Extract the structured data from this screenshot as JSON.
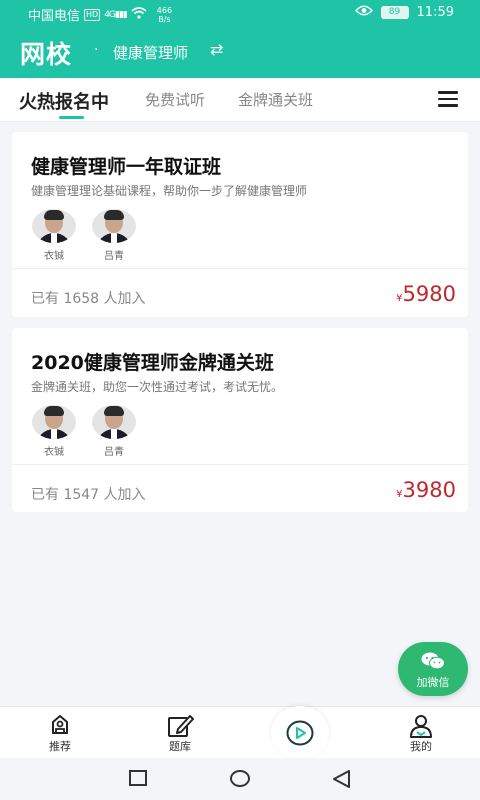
{
  "status_bar": {
    "carrier": "中国电信",
    "hd": "HD",
    "signal": "4G",
    "speed_value": "466",
    "speed_unit": "B/s",
    "battery": "89",
    "time": "11:59"
  },
  "header": {
    "brand": "网校",
    "separator": "·",
    "course": "健康管理师",
    "switch_icon": "⇄"
  },
  "tabs": [
    {
      "label": "火热报名中",
      "active": true
    },
    {
      "label": "免费试听",
      "active": false
    },
    {
      "label": "金牌通关班",
      "active": false
    }
  ],
  "courses": [
    {
      "title": "健康管理师一年取证班",
      "description": "健康管理理论基础课程，帮助你一步了解健康管理师",
      "teachers": [
        {
          "name": "衣铖"
        },
        {
          "name": "吕青"
        }
      ],
      "enrolled_prefix": "已有 ",
      "enrolled_count": "1658",
      "enrolled_suffix": " 人加入",
      "currency": "¥",
      "price": "5980"
    },
    {
      "title": "2020健康管理师金牌通关班",
      "description": "金牌通关班，助您一次性通过考试，考试无忧。",
      "teachers": [
        {
          "name": "衣铖"
        },
        {
          "name": "吕青"
        }
      ],
      "enrolled_prefix": "已有 ",
      "enrolled_count": "1547",
      "enrolled_suffix": " 人加入",
      "currency": "¥",
      "price": "3980"
    }
  ],
  "wechat_button": {
    "label": "加微信",
    "icon": "wechat-icon"
  },
  "bottom_nav": [
    {
      "label": "推荐",
      "icon": "home-icon"
    },
    {
      "label": "题库",
      "icon": "edit-icon"
    },
    {
      "label": "",
      "icon": "play-icon"
    },
    {
      "label": "我的",
      "icon": "user-icon"
    }
  ],
  "colors": {
    "accent": "#1ec4a5",
    "price": "#c0272d",
    "wechat": "#2eb872"
  }
}
